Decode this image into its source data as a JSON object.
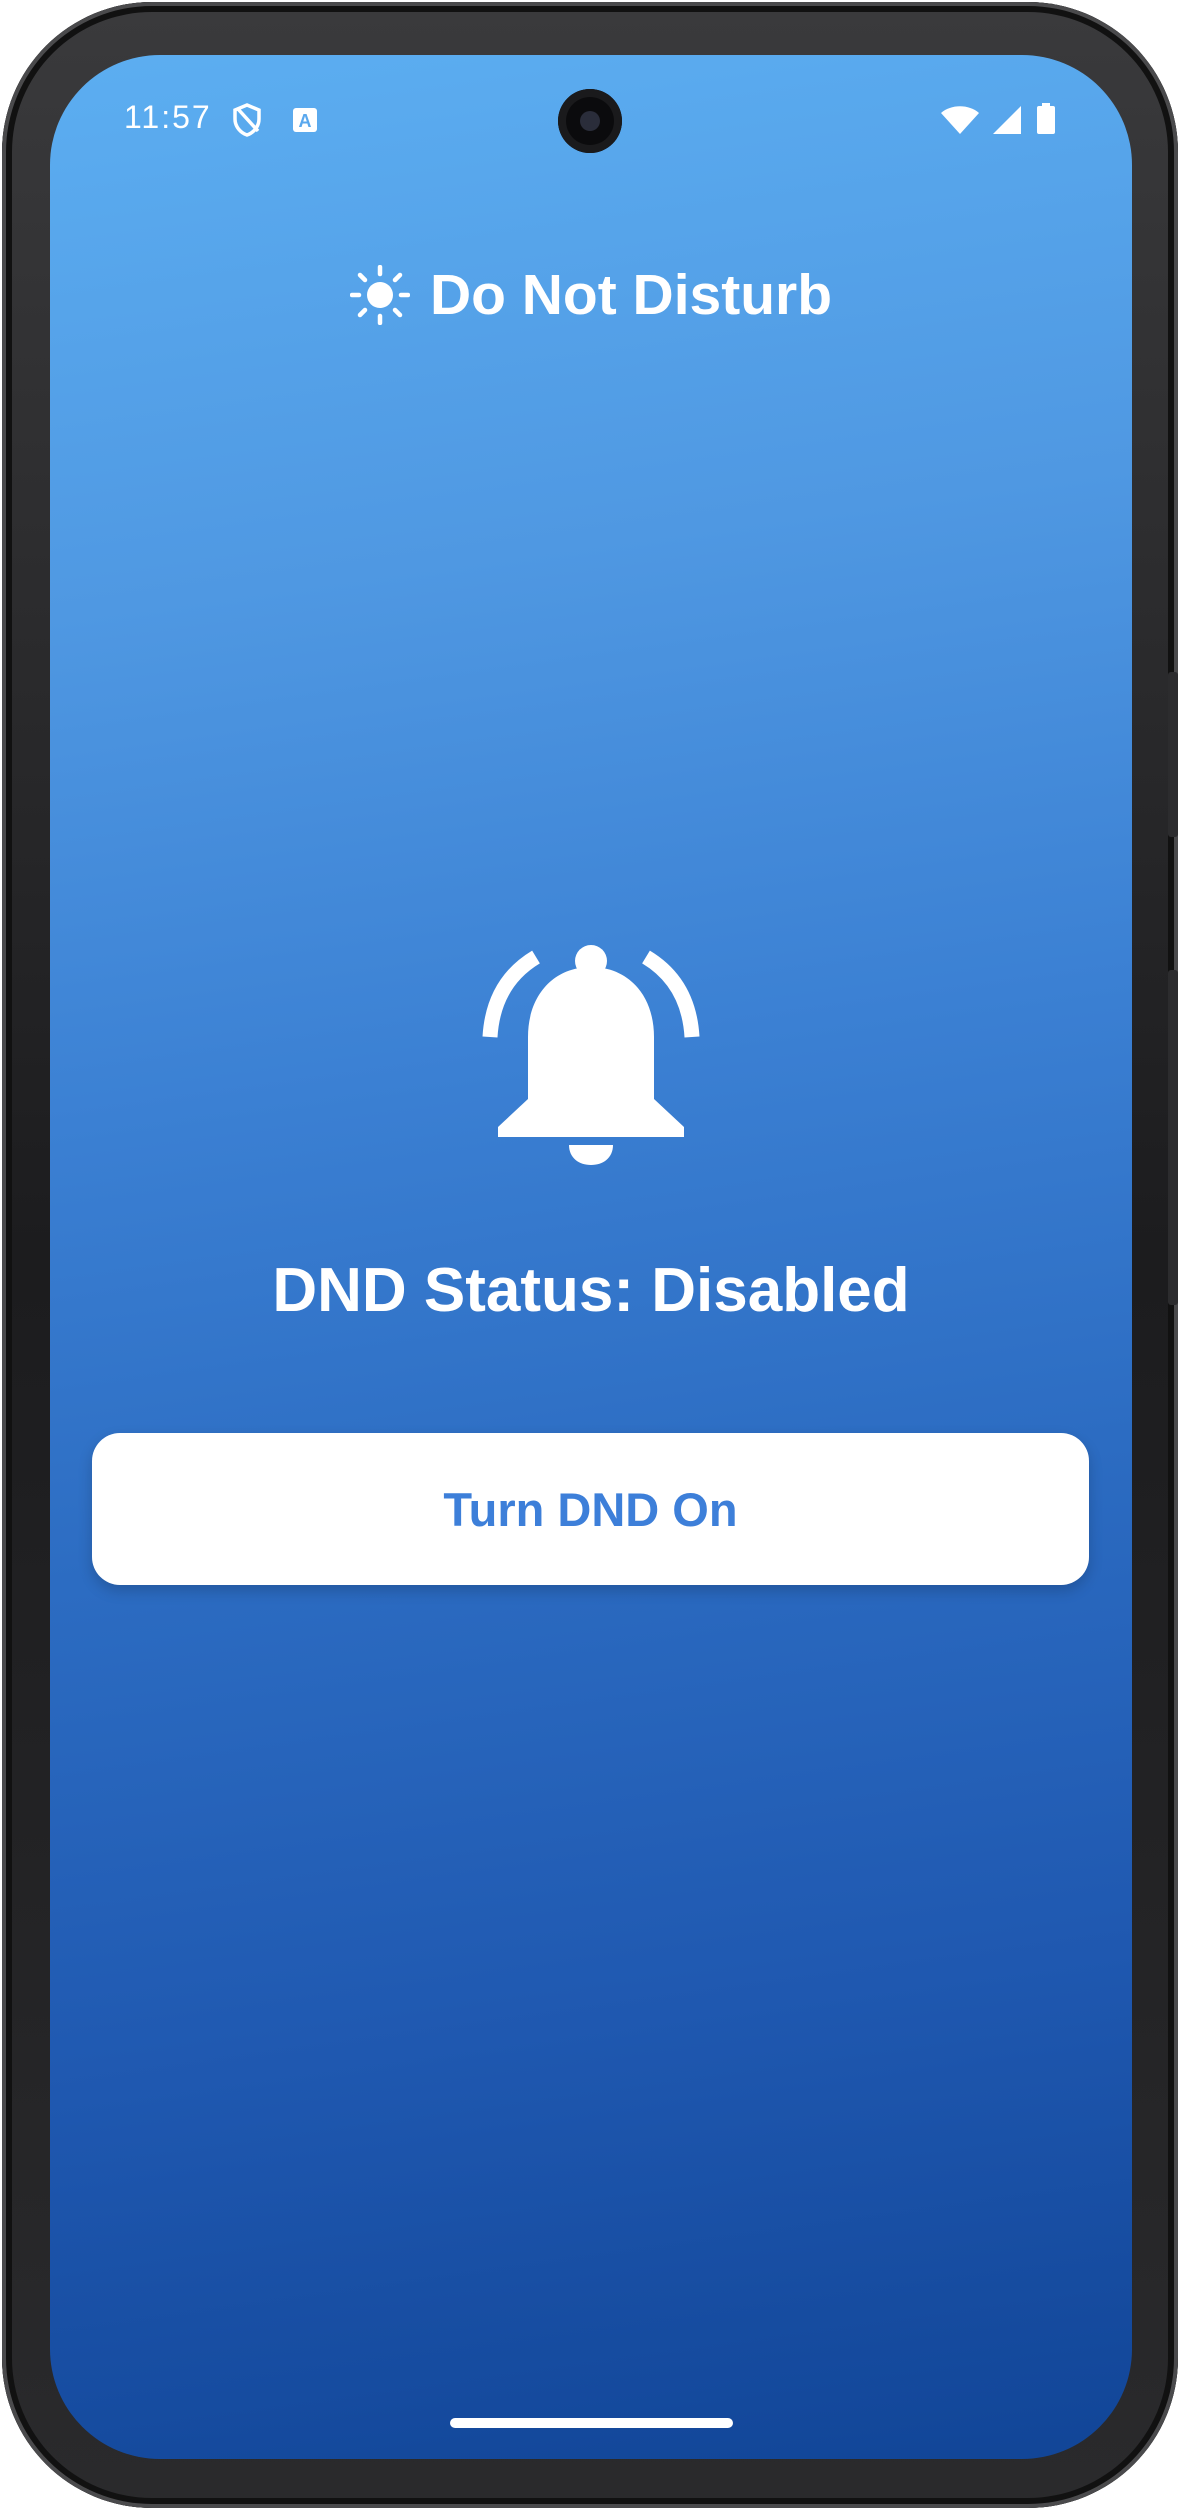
{
  "status_bar": {
    "time": "11:57",
    "icons": [
      "shield-icon",
      "a-badge-icon",
      "wifi-icon",
      "signal-icon",
      "battery-icon"
    ]
  },
  "header": {
    "icon": "sun-icon",
    "title": "Do Not Disturb"
  },
  "main": {
    "icon": "bell-ringing-icon",
    "status_text": "DND Status: Disabled",
    "button_label": "Turn DND On"
  },
  "colors": {
    "gradient_top": "#5caef1",
    "gradient_bottom": "#114597",
    "button_bg": "#ffffff",
    "button_text": "#3d7fd9",
    "foreground": "#ffffff"
  }
}
